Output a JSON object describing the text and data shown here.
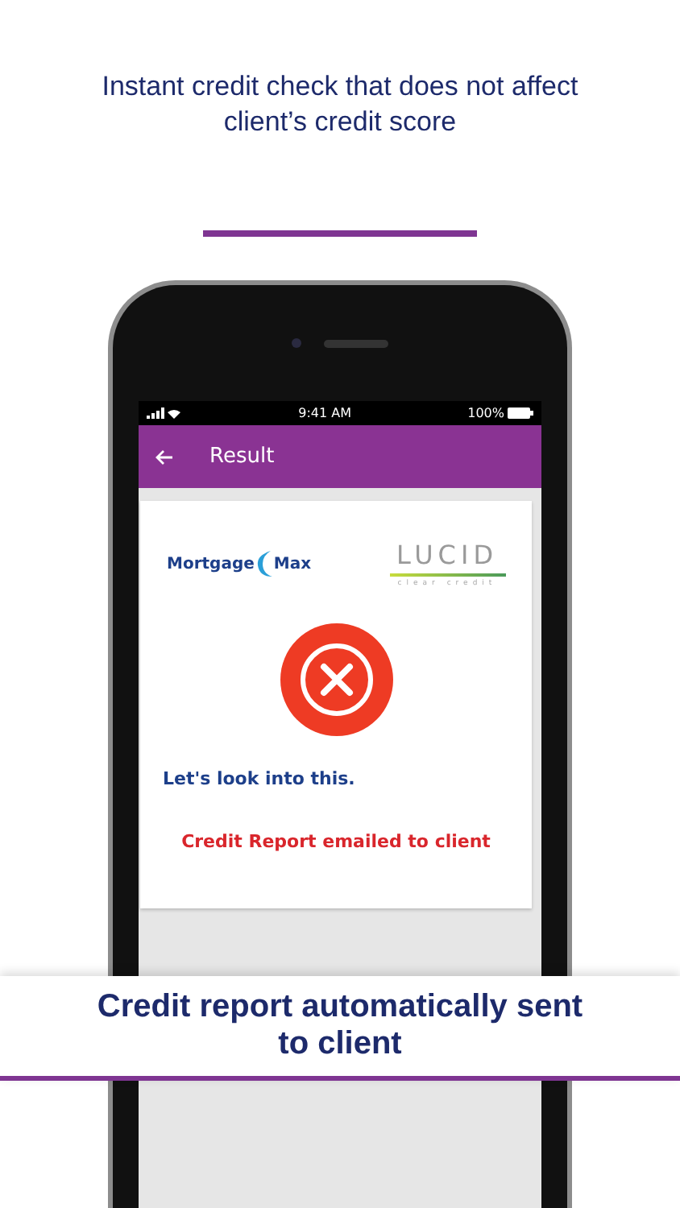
{
  "headline": "Instant credit check that does not affect client’s credit score",
  "status_bar": {
    "time": "9:41 AM",
    "battery": "100%"
  },
  "app_bar": {
    "title": "Result"
  },
  "card": {
    "logo_left": {
      "word": "Mortgage",
      "word2": "Max"
    },
    "logo_right": {
      "word": "LUCID",
      "tagline": "clear credit"
    },
    "kind": "error",
    "message": "Let's look into this.",
    "note": "Credit Report emailed to client"
  },
  "banner": "Credit report automatically sent to client"
}
